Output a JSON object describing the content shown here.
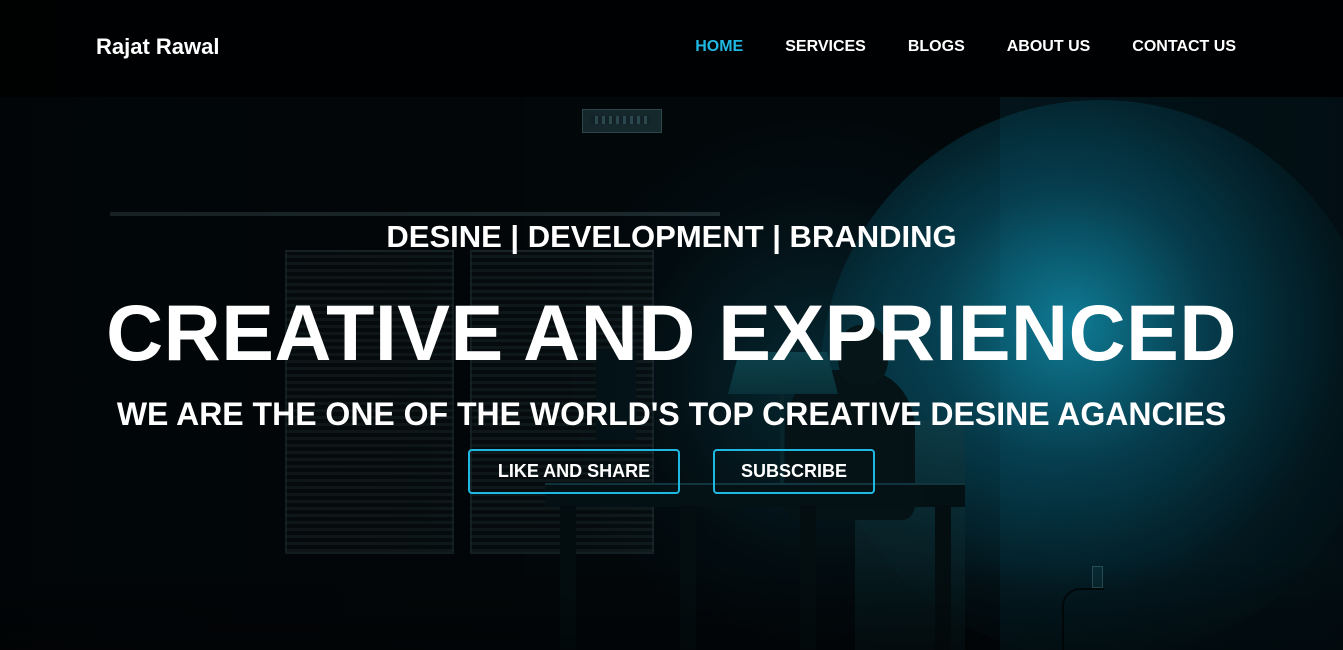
{
  "navbar": {
    "brand": "Rajat Rawal",
    "links": [
      {
        "label": "HOME",
        "active": true
      },
      {
        "label": "SERVICES",
        "active": false
      },
      {
        "label": "BLOGS",
        "active": false
      },
      {
        "label": "ABOUT US",
        "active": false
      },
      {
        "label": "CONTACT US",
        "active": false
      }
    ]
  },
  "hero": {
    "tagline": "DESINE | DEVELOPMENT | BRANDING",
    "headline": "CREATIVE AND EXPRIENCED",
    "subheadline": "WE ARE THE ONE OF THE WORLD'S TOP CREATIVE DESINE AGANCIES",
    "buttons": {
      "like_share": "LIKE AND SHARE",
      "subscribe": "SUBSCRIBE"
    },
    "background": "dark room with a hooded person working at a desk under a lamp, teal lighting"
  },
  "colors": {
    "accent": "#1fb8e2",
    "text": "#ffffff",
    "navbar_bg": "#000000"
  }
}
